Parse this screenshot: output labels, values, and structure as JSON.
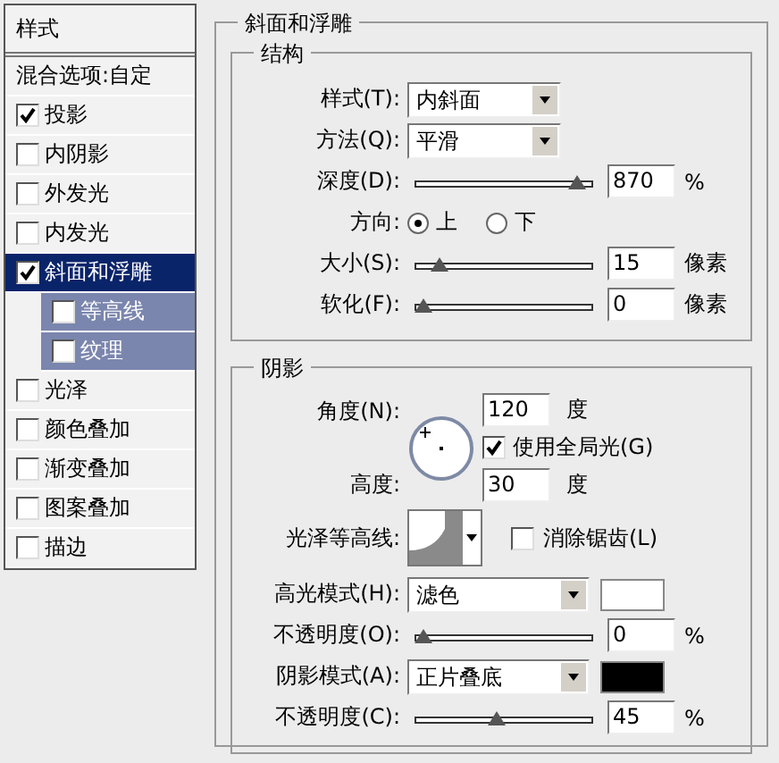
{
  "sidebar": {
    "title": "样式",
    "items": [
      {
        "kind": "plain",
        "label": "混合选项:自定",
        "selected": false
      },
      {
        "kind": "check",
        "label": "投影",
        "checked": true,
        "selected": false
      },
      {
        "kind": "check",
        "label": "内阴影",
        "checked": false,
        "selected": false
      },
      {
        "kind": "check",
        "label": "外发光",
        "checked": false,
        "selected": false
      },
      {
        "kind": "check",
        "label": "内发光",
        "checked": false,
        "selected": false
      },
      {
        "kind": "check",
        "label": "斜面和浮雕",
        "checked": true,
        "selected": true
      },
      {
        "kind": "sub",
        "label": "等高线",
        "checked": false,
        "selected": false
      },
      {
        "kind": "sub",
        "label": "纹理",
        "checked": false,
        "selected": false
      },
      {
        "kind": "check",
        "label": "光泽",
        "checked": false,
        "selected": false
      },
      {
        "kind": "check",
        "label": "颜色叠加",
        "checked": false,
        "selected": false
      },
      {
        "kind": "check",
        "label": "渐变叠加",
        "checked": false,
        "selected": false
      },
      {
        "kind": "check",
        "label": "图案叠加",
        "checked": false,
        "selected": false
      },
      {
        "kind": "check",
        "label": "描边",
        "checked": false,
        "selected": false
      }
    ]
  },
  "panel": {
    "title": "斜面和浮雕",
    "structure": {
      "title": "结构",
      "rows": [
        {
          "kind": "select",
          "label": "样式(T):",
          "value": "内斜面"
        },
        {
          "kind": "select",
          "label": "方法(Q):",
          "value": "平滑"
        },
        {
          "kind": "slider",
          "label": "深度(D):",
          "level": 0.93,
          "value": "870",
          "unit": "%"
        },
        {
          "kind": "radio",
          "label": "方向:",
          "options": [
            {
              "label": "上",
              "selected": true
            },
            {
              "label": "下",
              "selected": false
            }
          ]
        },
        {
          "kind": "slider",
          "label": "大小(S):",
          "level": 0.1,
          "value": "15",
          "unit": "像素"
        },
        {
          "kind": "slider",
          "label": "软化(F):",
          "level": 0,
          "value": "0",
          "unit": "像素"
        }
      ]
    },
    "shading": {
      "title": "阴影",
      "angle": {
        "label": "角度(N):",
        "value": "120",
        "unit": "度"
      },
      "global_light": {
        "label": "使用全局光(G)",
        "checked": true
      },
      "altitude": {
        "label": "高度:",
        "value": "30",
        "unit": "度"
      },
      "gloss_contour": {
        "label": "光泽等高线:"
      },
      "anti_alias": {
        "label": "消除锯齿(L)",
        "checked": false
      },
      "rows": [
        {
          "kind": "select",
          "label": "高光模式(H):",
          "value": "滤色",
          "color": "#ffffff"
        },
        {
          "kind": "slider",
          "label": "不透明度(O):",
          "level": 0,
          "value": "0",
          "unit": "%"
        },
        {
          "kind": "select",
          "label": "阴影模式(A):",
          "value": "正片叠底",
          "color": "#000000"
        },
        {
          "kind": "slider",
          "label": "不透明度(C):",
          "level": 0.45,
          "value": "45",
          "unit": "%"
        }
      ]
    }
  }
}
